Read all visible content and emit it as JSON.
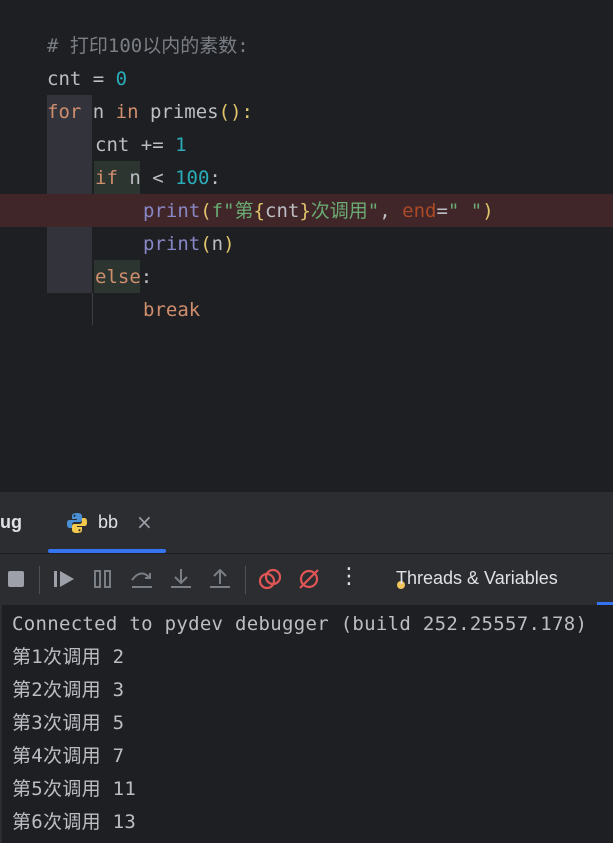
{
  "editor": {
    "lines": [
      {
        "id": "comment",
        "text": "# 打印100以内的素数:"
      },
      {
        "id": "cnt_init_var",
        "text": "cnt"
      },
      {
        "id": "cnt_init_eq",
        "text": " = "
      },
      {
        "id": "cnt_init_val",
        "text": "0"
      },
      {
        "id": "for_kw",
        "text": "for"
      },
      {
        "id": "for_n",
        "text": " n "
      },
      {
        "id": "for_in",
        "text": "in"
      },
      {
        "id": "for_call",
        "text": " primes"
      },
      {
        "id": "for_paren",
        "text": "():"
      }
    ],
    "l3_var": "cnt",
    "l3_op": " += ",
    "l3_num": "1",
    "l4_kw": "if",
    "l4_mid": " n < ",
    "l4_num": "100",
    "l4_end": ":",
    "l5_fn": "print",
    "l5_p1": "(",
    "l5_str1": "f\"第",
    "l5_brace1": "{",
    "l5_cnt": "cnt",
    "l5_brace2": "}",
    "l5_str2": "次调用\"",
    "l5_comma": ", ",
    "l5_param": "end",
    "l5_eq": "=",
    "l5_str3": "\" \"",
    "l5_p2": ")",
    "l6_fn": "print",
    "l6_p1": "(",
    "l6_arg": "n",
    "l6_p2": ")",
    "l7_kw": "else",
    "l7_colon": ":",
    "l8_kw": "break"
  },
  "tabbar": {
    "debug_label": "ug",
    "tab_label": "bb",
    "close_glyph": "×"
  },
  "toolbar": {
    "threads_label": "Threads & Variables",
    "more_glyph": "⋮"
  },
  "console": {
    "lines": [
      "Connected to pydev debugger (build 252.25557.178)",
      "第1次调用 2",
      "第2次调用 3",
      "第3次调用 5",
      "第4次调用 7",
      "第5次调用 11",
      "第6次调用 13"
    ]
  },
  "colors": {
    "keyword": "#cf8e6d",
    "number": "#2aacb8",
    "builtin": "#8888c6",
    "string": "#6aab73",
    "comment": "#7a7e85",
    "param": "#aa4926",
    "breakpoint_line": "#402629",
    "accent": "#3574f0"
  }
}
